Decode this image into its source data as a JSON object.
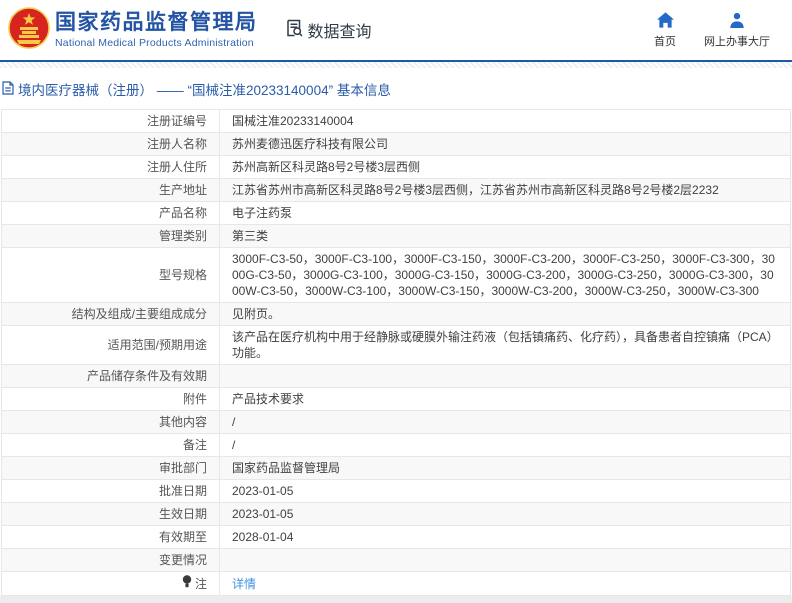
{
  "header": {
    "agency_name_cn": "国家药品监督管理局",
    "agency_name_en": "National Medical Products Administration",
    "logo_icon": "national-emblem-logo",
    "section": {
      "label": "数据查询",
      "icon": "document-search-icon"
    },
    "nav": [
      {
        "label": "首页",
        "icon": "home-icon"
      },
      {
        "label": "网上办事大厅",
        "icon": "person-icon"
      }
    ]
  },
  "breadcrumb": {
    "icon": "document-icon",
    "text": "境内医疗器械（注册） —— “国械注准20233140004” 基本信息"
  },
  "table": {
    "rows": [
      {
        "label": "注册证编号",
        "value": "国械注准20233140004"
      },
      {
        "label": "注册人名称",
        "value": "苏州麦德迅医疗科技有限公司"
      },
      {
        "label": "注册人住所",
        "value": "苏州高新区科灵路8号2号楼3层西侧"
      },
      {
        "label": "生产地址",
        "value": "江苏省苏州市高新区科灵路8号2号楼3层西侧，江苏省苏州市高新区科灵路8号2号楼2层2232"
      },
      {
        "label": "产品名称",
        "value": "电子注药泵"
      },
      {
        "label": "管理类别",
        "value": "第三类"
      },
      {
        "label": "型号规格",
        "value": "3000F-C3-50，3000F-C3-100，3000F-C3-150，3000F-C3-200，3000F-C3-250，3000F-C3-300，3000G-C3-50，3000G-C3-100，3000G-C3-150，3000G-C3-200，3000G-C3-250，3000G-C3-300，3000W-C3-50，3000W-C3-100，3000W-C3-150，3000W-C3-200，3000W-C3-250，3000W-C3-300"
      },
      {
        "label": "结构及组成/主要组成成分",
        "value": "见附页。"
      },
      {
        "label": "适用范围/预期用途",
        "value": "该产品在医疗机构中用于经静脉或硬膜外输注药液（包括镇痛药、化疗药），具备患者自控镇痛（PCA）功能。"
      },
      {
        "label": "产品储存条件及有效期",
        "value": ""
      },
      {
        "label": "附件",
        "value": "产品技术要求"
      },
      {
        "label": "其他内容",
        "value": "/"
      },
      {
        "label": "备注",
        "value": "/"
      },
      {
        "label": "审批部门",
        "value": "国家药品监督管理局"
      },
      {
        "label": "批准日期",
        "value": "2023-01-05"
      },
      {
        "label": "生效日期",
        "value": "2023-01-05"
      },
      {
        "label": "有效期至",
        "value": "2028-01-04"
      },
      {
        "label": "变更情况",
        "value": ""
      },
      {
        "label": "注",
        "label_icon": "bulb-icon",
        "link_label": "详情"
      }
    ]
  },
  "colors": {
    "accent_blue": "#2353a3",
    "breadcrumb_blue": "#2a5caa",
    "link_blue": "#4291e2",
    "nav_icon_blue": "#2468c8",
    "emblem_red": "#d6251f",
    "emblem_gold": "#f7c948",
    "border_gray": "#e7e7e7",
    "stripe_gray": "#f8f8f8"
  }
}
